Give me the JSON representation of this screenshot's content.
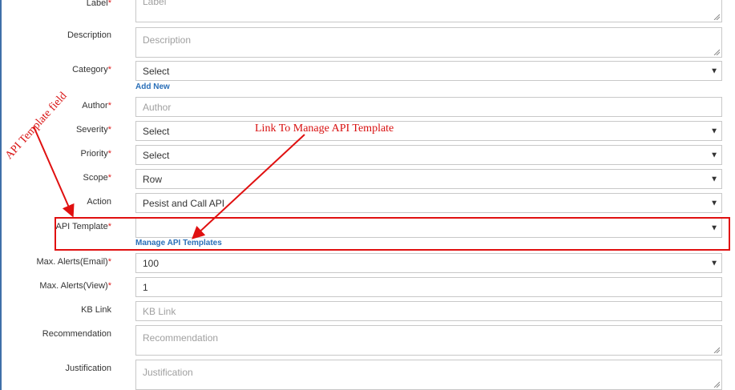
{
  "form": {
    "label": {
      "label": "Label",
      "placeholder": "Label"
    },
    "description": {
      "label": "Description",
      "placeholder": "Description"
    },
    "category": {
      "label": "Category",
      "value": "Select",
      "add_new": "Add New"
    },
    "author": {
      "label": "Author",
      "placeholder": "Author"
    },
    "severity": {
      "label": "Severity",
      "value": "Select"
    },
    "priority": {
      "label": "Priority",
      "value": "Select"
    },
    "scope": {
      "label": "Scope",
      "value": "Row"
    },
    "action": {
      "label": "Action",
      "value": "Pesist and Call API"
    },
    "api_template": {
      "label": "API Template",
      "value": "",
      "manage_link": "Manage API Templates"
    },
    "max_alerts_email": {
      "label": "Max. Alerts(Email)",
      "value": "100"
    },
    "max_alerts_view": {
      "label": "Max. Alerts(View)",
      "value": "1"
    },
    "kb_link": {
      "label": "KB Link",
      "placeholder": "KB Link"
    },
    "recommendation": {
      "label": "Recommendation",
      "placeholder": "Recommendation"
    },
    "justification": {
      "label": "Justification",
      "placeholder": "Justification"
    },
    "required_marker": "*"
  },
  "annotations": {
    "api_template_field": "API Template field",
    "link_to_manage": "Link To Manage API Template",
    "color": "#d81010"
  }
}
